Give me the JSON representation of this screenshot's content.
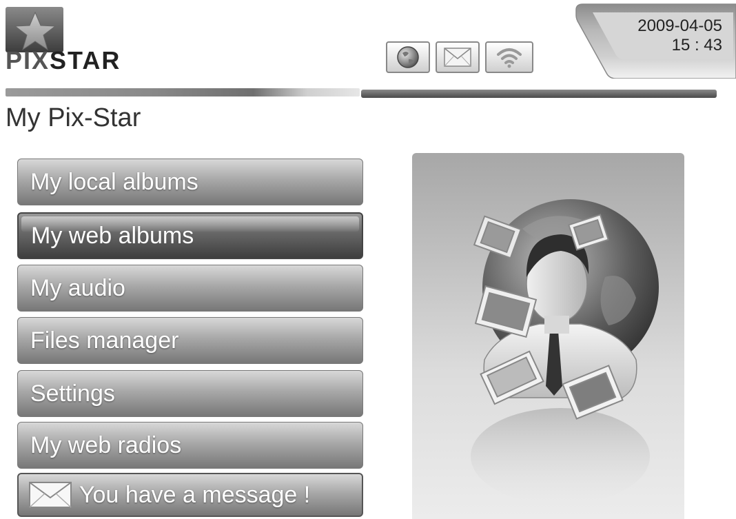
{
  "header": {
    "brand": {
      "part1": "PIX",
      "part2": "STAR"
    },
    "status_icons": [
      {
        "name": "globe-icon"
      },
      {
        "name": "envelope-icon"
      },
      {
        "name": "wifi-icon"
      }
    ],
    "date": "2009-04-05",
    "time": "15 : 43"
  },
  "page": {
    "title": "My Pix-Star"
  },
  "menu": {
    "items": [
      {
        "label": "My local albums",
        "selected": false
      },
      {
        "label": "My web albums",
        "selected": true
      },
      {
        "label": "My audio",
        "selected": false
      },
      {
        "label": "Files manager",
        "selected": false
      },
      {
        "label": "Settings",
        "selected": false
      },
      {
        "label": "My web radios",
        "selected": false
      }
    ],
    "message": {
      "label": "You have a message !",
      "icon": "envelope-icon"
    }
  },
  "preview": {
    "illustration": "globe-person-photos-illustration"
  },
  "colors": {
    "accent_dark": "#3e3e3e",
    "menu_light": "#d8d8d8",
    "background": "#ffffff"
  }
}
